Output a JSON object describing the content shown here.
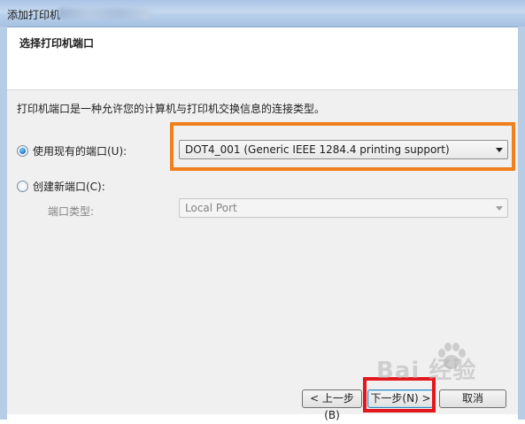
{
  "window": {
    "title": "添加打印机"
  },
  "header": {
    "title": "选择打印机端口"
  },
  "content": {
    "description": "打印机端口是一种允许您的计算机与打印机交换信息的连接类型。",
    "use_existing": {
      "label": "使用现有的端口(U):",
      "selected": true
    },
    "existing_port": {
      "value": "DOT4_001 (Generic IEEE 1284.4 printing support)"
    },
    "create_new": {
      "label": "创建新端口(C):",
      "selected": false
    },
    "port_type": {
      "label": "端口类型:",
      "value": "Local Port"
    }
  },
  "footer": {
    "back_label": "< 上一步(B)",
    "next_label": "下一步(N) >",
    "cancel_label": "取消"
  },
  "watermark": {
    "text": "Bai 经验"
  },
  "colors": {
    "highlight_orange": "#f07f1d",
    "highlight_red": "#e4171c",
    "titlebar": "#b7cfe9"
  }
}
